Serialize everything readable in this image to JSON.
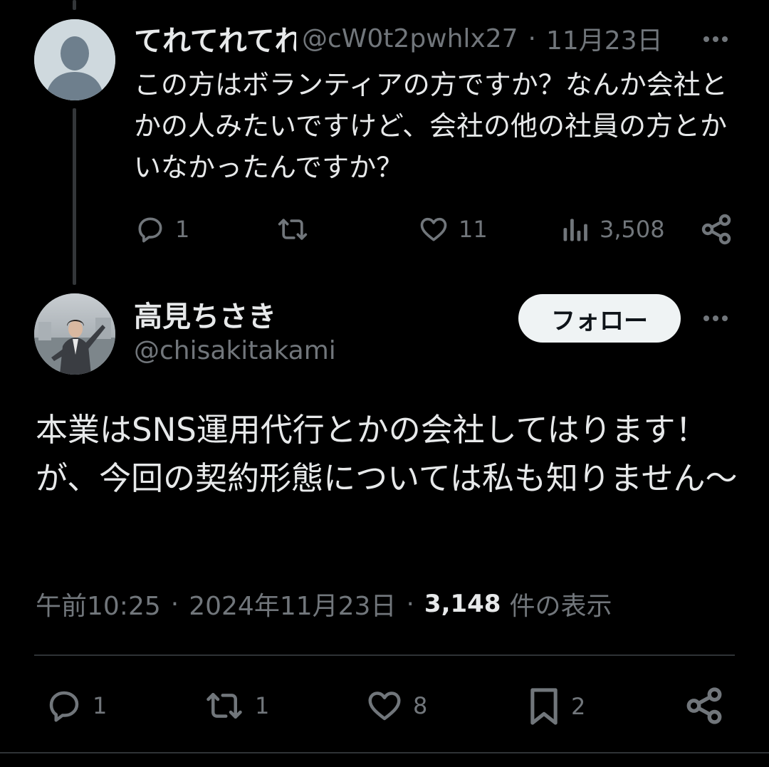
{
  "reply": {
    "display_name": "てれてれてれ",
    "handle": "@cW0t2pwhlx27",
    "separator": "·",
    "date": "11月23日",
    "text": "この方はボランティアの方ですか？なんか会社とかの人みたいですけど、会社の他の社員の方とかいなかったんですか？",
    "actions": {
      "reply_count": "1",
      "retweet_count": "",
      "like_count": "11",
      "view_count": "3,508"
    }
  },
  "main_tweet": {
    "display_name": "高見ちさき",
    "handle": "@chisakitakami",
    "follow_label": "フォロー",
    "text": "本業はSNS運用代行とかの会社してはります！が、今回の契約形態については私も知りません〜",
    "meta": {
      "time": "午前10:25",
      "separator": "·",
      "date": "2024年11月23日",
      "views": "3,148",
      "views_suffix": "件の表示"
    },
    "actions": {
      "reply_count": "1",
      "retweet_count": "1",
      "like_count": "8",
      "bookmark_count": "2"
    }
  },
  "colors": {
    "background": "#000000",
    "text_primary": "#e7e9ea",
    "text_secondary": "#71767b",
    "divider": "#2f3336",
    "follow_button_bg": "#eff3f4"
  },
  "icons": [
    "default-avatar-icon",
    "more-icon",
    "reply-icon",
    "retweet-icon",
    "like-icon",
    "views-icon",
    "share-icon",
    "bookmark-icon"
  ]
}
